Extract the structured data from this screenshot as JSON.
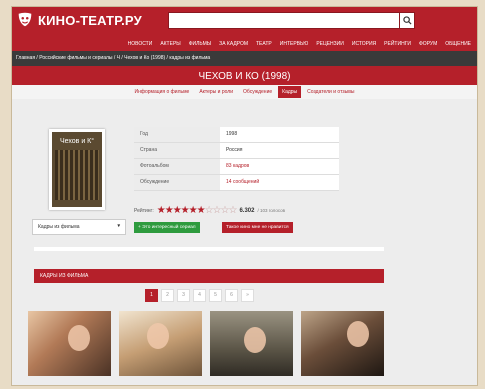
{
  "header": {
    "logo_text": "КИНО-ТЕАТР.РУ",
    "search_placeholder": "",
    "search_icon": "search-icon",
    "brand_color": "#b5202a"
  },
  "nav": {
    "items": [
      "НОВОСТИ",
      "АКТЕРЫ",
      "ФИЛЬМЫ",
      "ЗА КАДРОМ",
      "ТЕАТР",
      "ИНТЕРВЬЮ",
      "РЕЦЕНЗИИ",
      "ИСТОРИЯ",
      "РЕЙТИНГИ",
      "ФОРУМ",
      "ОБЩЕНИЕ"
    ]
  },
  "breadcrumb": "Главная / Российские фильмы и сериалы / Ч / Чехов и Ко (1998) / кадры из фильма",
  "page_title": "ЧЕХОВ И КО (1998)",
  "tabs": [
    {
      "label": "Информация о фильме",
      "active": false
    },
    {
      "label": "Актеры и роли",
      "active": false
    },
    {
      "label": "Обсуждение",
      "active": false
    },
    {
      "label": "Кадры",
      "active": true
    },
    {
      "label": "Создатели и отзывы",
      "active": false
    }
  ],
  "poster": {
    "title": "Чехов и К°"
  },
  "frames_select": {
    "value": "Кадры из фильма",
    "arrow": "▾"
  },
  "info": {
    "rows": [
      {
        "key": "Год",
        "value": "1998",
        "link": false
      },
      {
        "key": "Страна",
        "value": "Россия",
        "link": false
      },
      {
        "key": "Фотоальбом",
        "value": "83 кадров",
        "link": true
      },
      {
        "key": "Обсуждение",
        "value": "14 сообщений",
        "link": true
      }
    ]
  },
  "rating": {
    "label": "Рейтинг:",
    "score": "6.302",
    "votes": "/ 103 голосов",
    "stars_filled": 6,
    "stars_total": 10
  },
  "buttons": {
    "like": "+ Это интересный сериал",
    "dislike": "Такое кино мне не нравится"
  },
  "section": {
    "title": "КАДРЫ ИЗ ФИЛЬМА"
  },
  "pager": {
    "pages": [
      "1",
      "2",
      "3",
      "4",
      "5",
      "6",
      "»"
    ],
    "active": 0
  }
}
